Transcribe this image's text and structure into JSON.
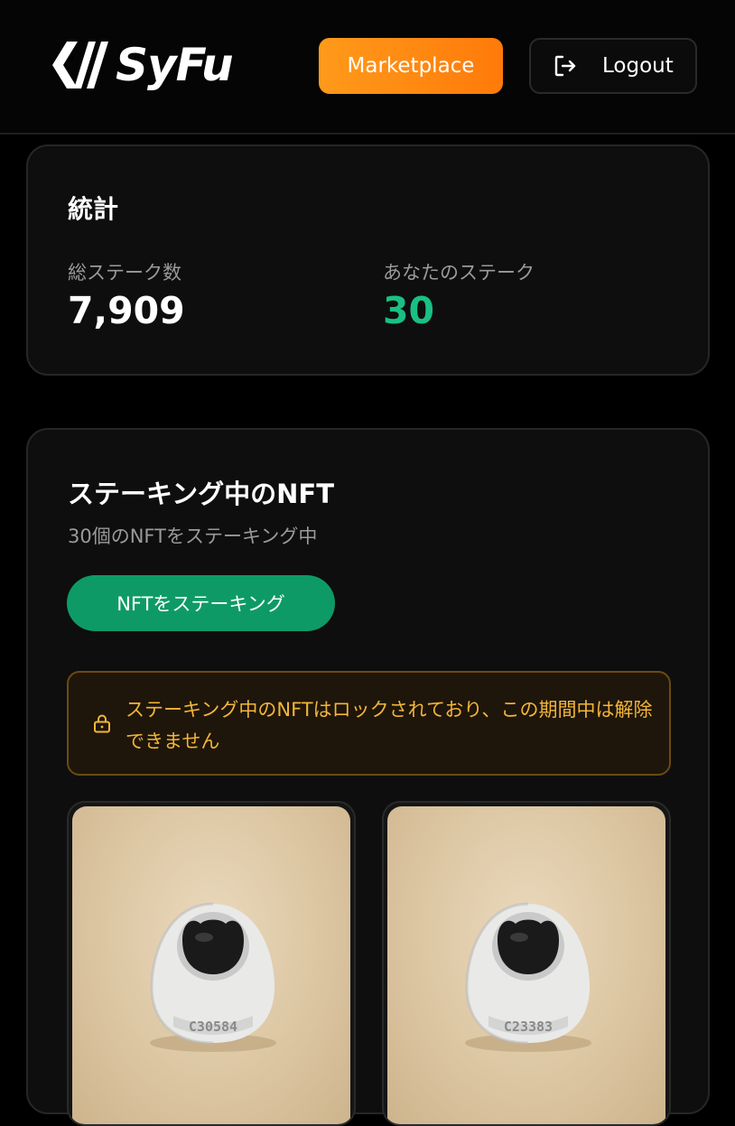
{
  "header": {
    "logo_text": "SyFu",
    "marketplace_label": "Marketplace",
    "logout_label": "Logout"
  },
  "stats": {
    "title": "統計",
    "total_label": "総ステーク数",
    "total_value": "7,909",
    "yours_label": "あなたのステーク",
    "yours_value": "30"
  },
  "staking": {
    "title": "ステーキング中のNFT",
    "subtitle": "30個のNFTをステーキング中",
    "stake_button_label": "NFTをステーキング",
    "warning": "ステーキング中のNFTはロックされており、この期間中は解除できません",
    "nfts": [
      {
        "code": "C30584",
        "icon": "egg-robot-nft-image"
      },
      {
        "code": "C23383",
        "icon": "egg-robot-nft-image"
      }
    ]
  },
  "colors": {
    "accent_orange": "#ff8a12",
    "accent_green": "#0e9a67",
    "stat_green": "#19c084",
    "warning_text": "#f3b53a"
  }
}
